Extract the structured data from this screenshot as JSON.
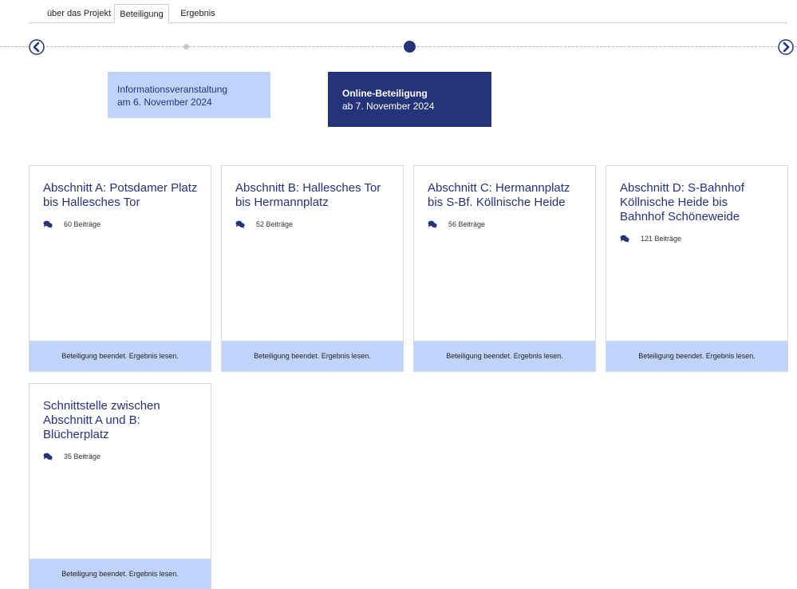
{
  "tabs": [
    {
      "label": "über das Projekt"
    },
    {
      "label": "Beteiligung"
    },
    {
      "label": "Ergebnis"
    }
  ],
  "phases": [
    {
      "title": "Informationsveranstaltung",
      "date": "am 6. November 2024"
    },
    {
      "title": "Online-Beteiligung",
      "date": "ab 7. November 2024"
    }
  ],
  "cards": [
    {
      "title": "Abschnitt A: Potsdamer Platz bis Hallesches Tor",
      "count": "60 Beiträge",
      "footer": "Beteiligung beendet. Ergebnis lesen."
    },
    {
      "title": "Abschnitt B: Hallesches Tor bis Hermannplatz",
      "count": "52 Beiträge",
      "footer": "Beteiligung beendet. Ergebnis lesen."
    },
    {
      "title": "Abschnitt C: Hermannplatz bis S-Bf. Köllnische Heide",
      "count": "56 Beiträge",
      "footer": "Beteiligung beendet. Ergebnis lesen."
    },
    {
      "title": "Abschnitt D: S-Bahnhof Köllnische Heide bis Bahnhof Schöneweide",
      "count": "121 Beiträge",
      "footer": "Beteiligung beendet. Ergebnis lesen."
    },
    {
      "title": "Schnittstelle zwischen Abschnitt A und B: Blücherplatz",
      "count": "35 Beiträge",
      "footer": "Beteiligung beendet. Ergebnis lesen."
    }
  ],
  "colors": {
    "primary": "#24337a",
    "light": "#c0d4fb"
  },
  "icons": {
    "prev": "chevron-left-icon",
    "next": "chevron-right-icon",
    "comments": "comments-icon"
  }
}
